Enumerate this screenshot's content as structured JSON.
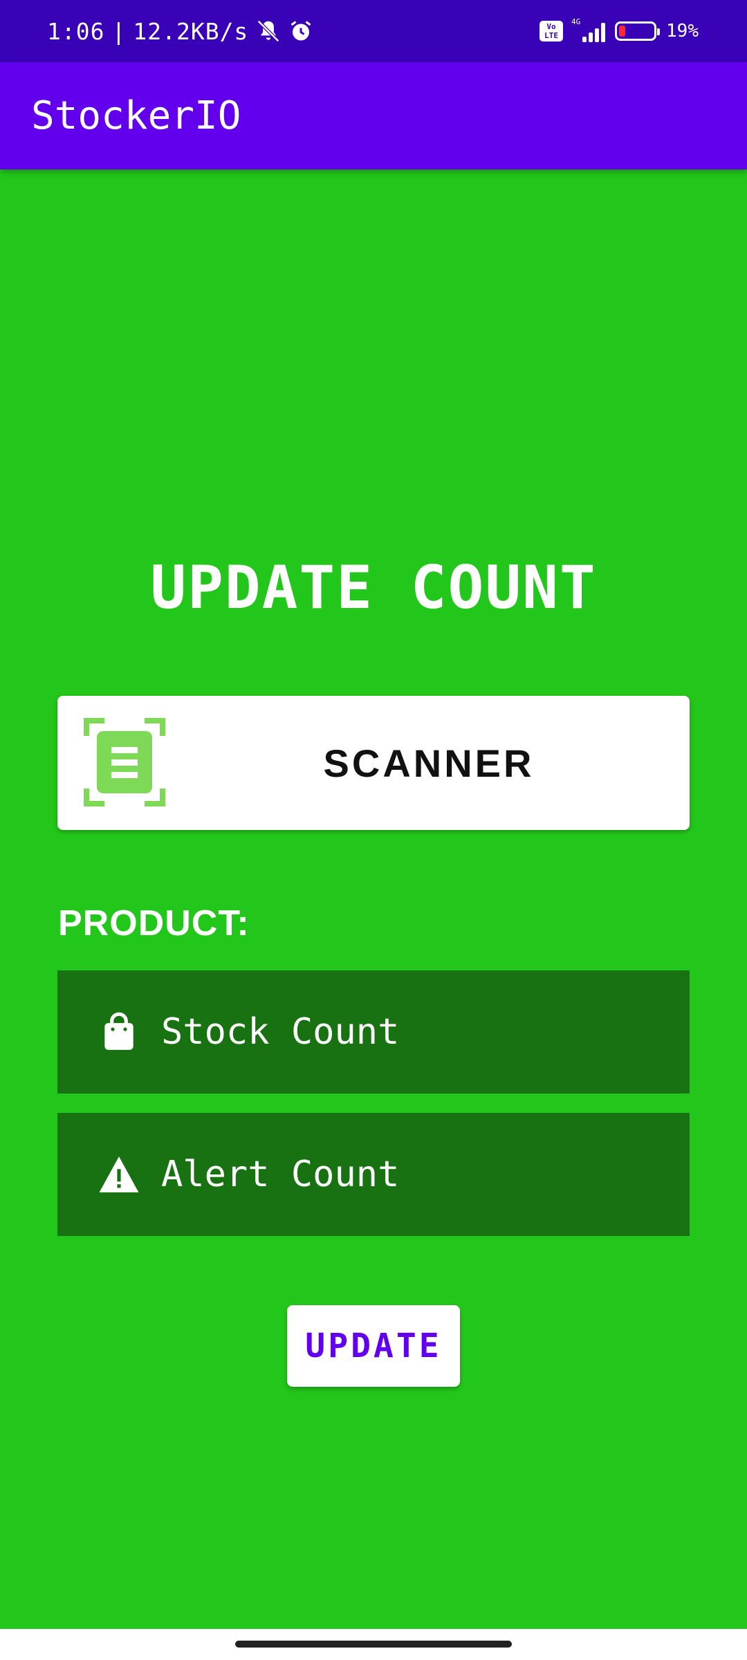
{
  "status_bar": {
    "time": "1:06",
    "separator": "|",
    "speed": "12.2KB/s",
    "volte_top": "Vo",
    "volte_bottom": "LTE",
    "network": "4G",
    "battery": "19%",
    "battery_level_percent": 19,
    "icons": [
      "bell-muted-icon",
      "alarm-icon",
      "volte-icon",
      "signal-icon",
      "battery-icon"
    ]
  },
  "app_bar": {
    "title": "StockerIO"
  },
  "main": {
    "heading": "UPDATE COUNT",
    "scanner_button": {
      "label": "SCANNER",
      "icon": "barcode-scanner-icon"
    },
    "product_label": "PRODUCT:",
    "fields": {
      "stock": {
        "placeholder": "Stock Count",
        "icon": "shopping-bag-icon"
      },
      "alert": {
        "placeholder": "Alert Count",
        "icon": "warning-icon"
      }
    },
    "update_button": {
      "label": "UPDATE"
    }
  },
  "colors": {
    "status_bar": "#3a02b6",
    "app_bar": "#6200ee",
    "background": "#23c61a",
    "field_bg": "#187211",
    "scanner_icon": "#7ed957",
    "accent_text": "#6200ee"
  }
}
